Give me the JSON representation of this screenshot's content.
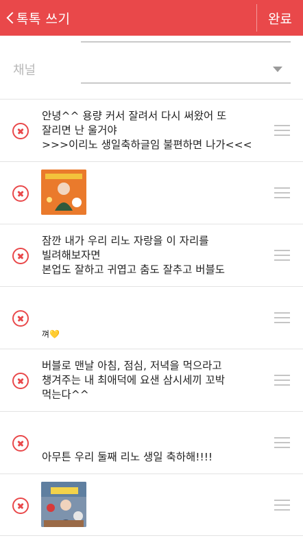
{
  "header": {
    "back_label": "톡톡 쓰기",
    "done_label": "완료",
    "color": "#e9484a"
  },
  "channel": {
    "label": "채널",
    "selected_value": ""
  },
  "items": [
    {
      "type": "text",
      "text": "안녕^^ 용량 커서 잘려서 다시 써왔어 또\n잘리면 난 울거야\n>>>이리노 생일축하글임 불편하면 나가<<<"
    },
    {
      "type": "image",
      "alt": "photo"
    },
    {
      "type": "text",
      "text": "잠깐 내가 우리 리노 자랑을 이 자리를\n빌려해보자면\n본업도 잘하고 귀엽고 춤도 잘추고 버블도"
    },
    {
      "type": "emoji",
      "text": "껴",
      "emoji": "💛"
    },
    {
      "type": "text",
      "text": "버블로 맨날 아침, 점심, 저녁을 먹으라고\n챙겨주는 내 최애덕에 요샌 삼시세끼 꼬박\n먹는다^^"
    },
    {
      "type": "text",
      "text": "아무튼 우리 둘째 리노 생일 축하해!!!!"
    },
    {
      "type": "image",
      "alt": "photo"
    }
  ]
}
